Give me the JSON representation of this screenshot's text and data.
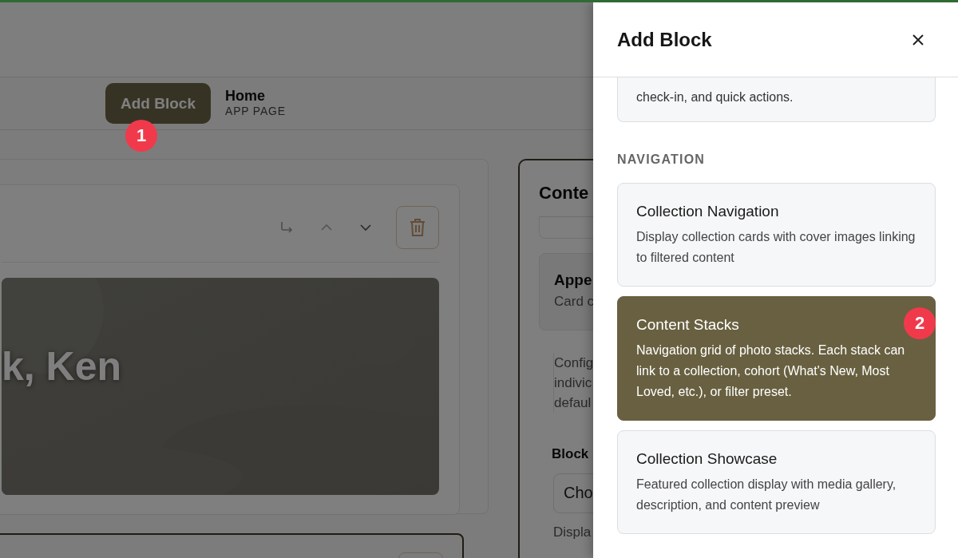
{
  "page": {
    "add_block_button": "Add Block",
    "page_title": "Home",
    "page_type": "APP PAGE",
    "hero_text": "k, Ken",
    "settings_panel": {
      "title": "Conte",
      "section_title": "Appe",
      "section_subtitle": "Card c",
      "description_lines": [
        "Config",
        "indivic",
        "defaul"
      ],
      "field_label": "Block",
      "select_value": "Cho",
      "help_text": "Displa"
    }
  },
  "drawer": {
    "title": "Add Block",
    "partial_card_lines": [
      "check-in, and quick actions."
    ],
    "sections": [
      {
        "heading": "NAVIGATION",
        "blocks": [
          {
            "title": "Collection Navigation",
            "description": "Display collection cards with cover images linking to filtered content",
            "selected": false
          },
          {
            "title": "Content Stacks",
            "description": "Navigation grid of photo stacks. Each stack can link to a collection, cohort (What's New, Most Loved, etc.), or filter preset.",
            "selected": true
          },
          {
            "title": "Collection Showcase",
            "description": "Featured collection display with media gallery, description, and content preview",
            "selected": false
          }
        ]
      }
    ]
  },
  "markers": [
    "1",
    "2"
  ]
}
